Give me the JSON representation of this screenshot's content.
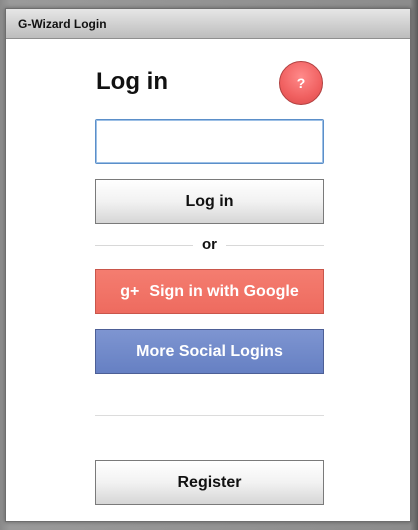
{
  "window": {
    "title": "G-Wizard Login"
  },
  "login": {
    "heading": "Log in",
    "help_label": "?",
    "username_value": "",
    "login_button": "Log in",
    "or_text": "or",
    "google_icon": "g+",
    "google_button": "Sign in with Google",
    "social_button": "More Social Logins",
    "register_button": "Register"
  },
  "colors": {
    "help_red": "#f06060",
    "google_red": "#ee6b5f",
    "social_blue": "#6680c3",
    "input_focus": "#5b8fc9"
  }
}
